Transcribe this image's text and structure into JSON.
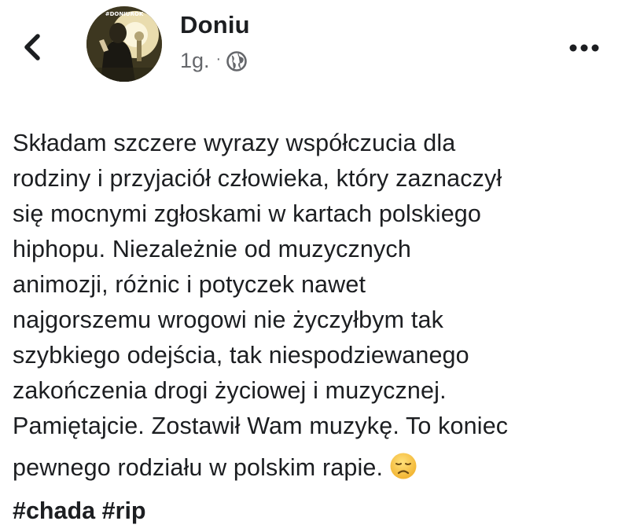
{
  "header": {
    "back_icon": "chevron-left-icon",
    "author": "Doniu",
    "time": "1g.",
    "separator": "·",
    "audience_icon": "globe-icon",
    "more_icon": "more-horizontal-icon",
    "avatar_caption": "#DONIUROK"
  },
  "post": {
    "lines": [
      "Składam szczere wyrazy współczucia dla",
      "rodziny i przyjaciół człowieka, który zaznaczył",
      "się mocnymi zgłoskami w kartach polskiego",
      "hiphopu. Niezależnie od muzycznych",
      "animozji, różnic i potyczek nawet",
      "najgorszemu wrogowi nie życzyłbym tak",
      "szybkiego odejścia, tak niespodziewanego",
      "zakończenia drogi życiowej i muzycznej.",
      "Pamiętajcie. Zostawił Wam muzykę. To koniec",
      "pewnego rodziału w polskim rapie."
    ],
    "emoji_icon": "disappointed-face-emoji-icon",
    "hashtags": [
      "#chada",
      "#rip"
    ]
  },
  "colors": {
    "text": "#1c1e21",
    "secondary": "#65676b",
    "emoji_face": "#f7c843"
  }
}
